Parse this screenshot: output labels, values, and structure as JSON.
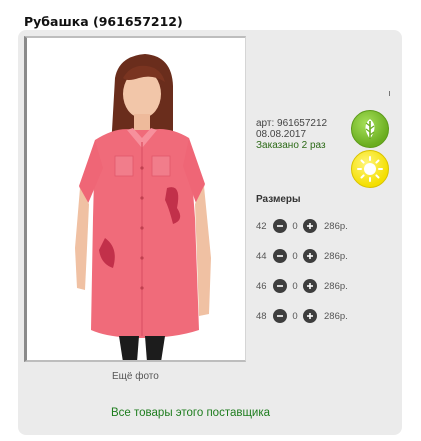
{
  "product": {
    "title": "Рубашка (961657212)",
    "more_photo": "Ещё фото",
    "sku": "арт: 961657212",
    "date": "08.08.2017",
    "ordered": "Заказано 2 раз"
  },
  "badges": [
    "leaf-icon",
    "sun-icon"
  ],
  "colors": {
    "card_bg": "#ebebeb",
    "link": "#1e7d1e",
    "ordered": "#2c6a17",
    "shirt": "#f06b7a"
  },
  "sizes": {
    "title": "Размеры",
    "rows": [
      {
        "size": "42",
        "qty": "0",
        "price": "286р."
      },
      {
        "size": "44",
        "qty": "0",
        "price": "286р."
      },
      {
        "size": "46",
        "qty": "0",
        "price": "286р."
      },
      {
        "size": "48",
        "qty": "0",
        "price": "286р."
      }
    ]
  },
  "supplier_link": "Все товары этого поставщика"
}
